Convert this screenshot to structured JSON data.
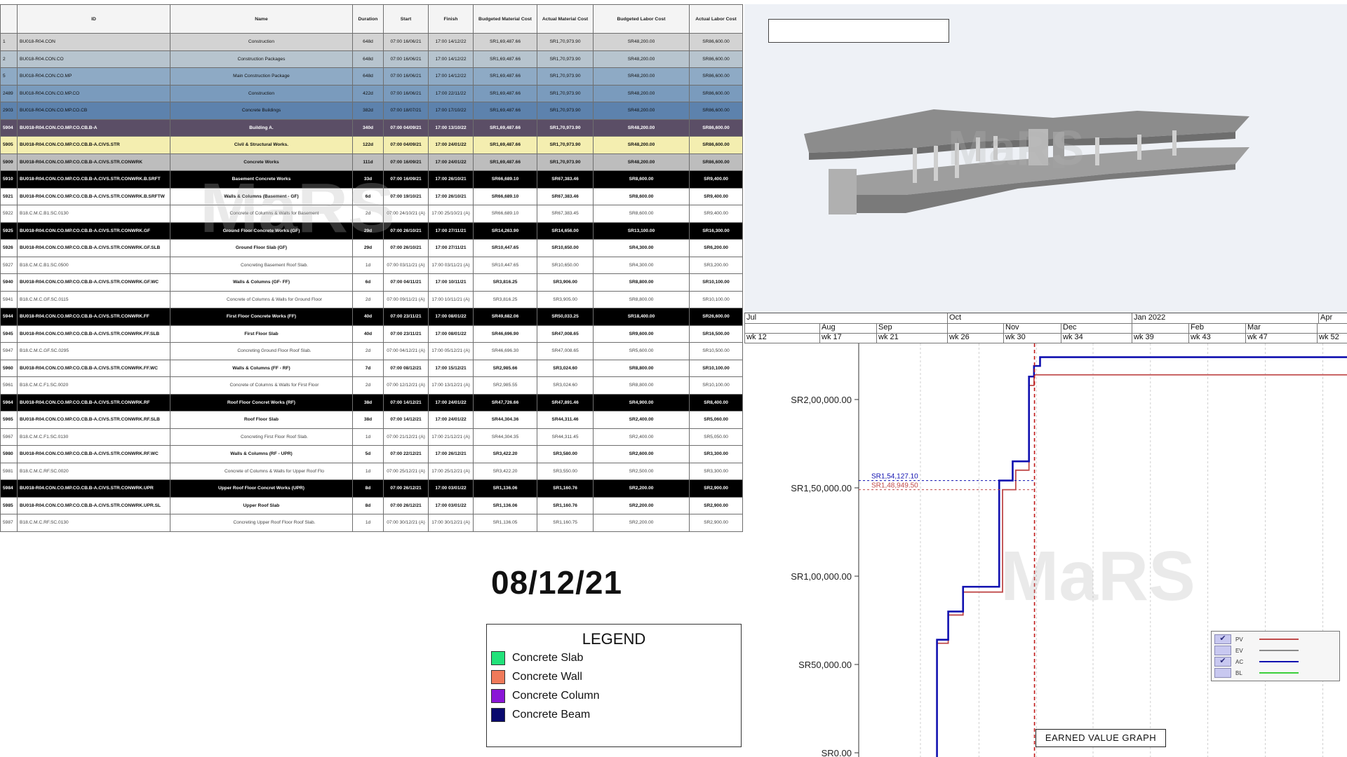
{
  "schedule": {
    "columns": [
      "ID",
      "Name",
      "Duration",
      "Start",
      "Finish",
      "Budgeted Material Cost",
      "Actual Material Cost",
      "Budgeted Labor Cost",
      "Actual Labor Cost"
    ],
    "rows": [
      {
        "no": "1",
        "id": "BU018-R04.CON",
        "name": "Construction",
        "dur": "648d",
        "start": "07:00 16/06/21",
        "finish": "17:00 14/12/22",
        "bmc": "SR1,69,487.66",
        "amc": "SR1,70,973.90",
        "blc": "SR48,200.00",
        "alc": "SR86,600.00",
        "style": "hl-gray",
        "indent": 0
      },
      {
        "no": "2",
        "id": "BU018-R04.CON.CO",
        "name": "Construction Packages",
        "dur": "648d",
        "start": "07:00 16/06/21",
        "finish": "17:00 14/12/22",
        "bmc": "SR1,69,487.66",
        "amc": "SR1,70,973.90",
        "blc": "SR48,200.00",
        "alc": "SR86,600.00",
        "style": "hl-steel",
        "indent": 1
      },
      {
        "no": "5",
        "id": "BU018-R04.CON.CO.MP",
        "name": "Main Construction Package",
        "dur": "648d",
        "start": "07:00 16/06/21",
        "finish": "17:00 14/12/22",
        "bmc": "SR1,69,487.66",
        "amc": "SR1,70,973.90",
        "blc": "SR48,200.00",
        "alc": "SR86,600.00",
        "style": "hl-blue",
        "indent": 2
      },
      {
        "no": "2489",
        "id": "BU018-R04.CON.CO.MP.CO",
        "name": "Construction",
        "dur": "422d",
        "start": "07:00 16/06/21",
        "finish": "17:00 22/11/22",
        "bmc": "SR1,69,487.66",
        "amc": "SR1,70,973.90",
        "blc": "SR48,200.00",
        "alc": "SR86,600.00",
        "style": "hl-blue2",
        "indent": 3
      },
      {
        "no": "2903",
        "id": "BU018-R04.CON.CO.MP.CO.CB",
        "name": "Concrete Buildings",
        "dur": "382d",
        "start": "07:00 18/07/21",
        "finish": "17:00 17/10/22",
        "bmc": "SR1,69,487.66",
        "amc": "SR1,70,973.90",
        "blc": "SR48,200.00",
        "alc": "SR86,600.00",
        "style": "hl-blue3",
        "indent": 4
      },
      {
        "no": "5904",
        "id": "BU018-R04.CON.CO.MP.CO.CB.B-A",
        "name": "Building A.",
        "dur": "340d",
        "start": "07:00 04/09/21",
        "finish": "17:00 13/10/22",
        "bmc": "SR1,69,487.66",
        "amc": "SR1,70,973.90",
        "blc": "SR48,200.00",
        "alc": "SR86,600.00",
        "style": "hl-purple",
        "indent": 5
      },
      {
        "no": "5905",
        "id": "BU018-R04.CON.CO.MP.CO.CB.B-A.CIVS.STR",
        "name": "Civil & Structural Works.",
        "dur": "122d",
        "start": "07:00 04/09/21",
        "finish": "17:00 24/01/22",
        "bmc": "SR1,69,487.66",
        "amc": "SR1,70,973.90",
        "blc": "SR48,200.00",
        "alc": "SR86,600.00",
        "style": "hl-yellow",
        "indent": 6
      },
      {
        "no": "5909",
        "id": "BU018-R04.CON.CO.MP.CO.CB.B-A.CIVS.STR.CONWRK",
        "name": "Concrete Works",
        "dur": "111d",
        "start": "07:00 16/09/21",
        "finish": "17:00 24/01/22",
        "bmc": "SR1,69,487.66",
        "amc": "SR1,70,973.90",
        "blc": "SR48,200.00",
        "alc": "SR86,600.00",
        "style": "hl-silver",
        "indent": 6
      },
      {
        "no": "5910",
        "id": "BU018-R04.CON.CO.MP.CO.CB.B-A.CIVS.STR.CONWRK.B.SRFT",
        "name": "Basement Concrete Works",
        "dur": "33d",
        "start": "07:00 16/09/21",
        "finish": "17:00 26/10/21",
        "bmc": "SR66,689.10",
        "amc": "SR67,383.46",
        "blc": "SR8,600.00",
        "alc": "SR9,400.00",
        "style": "hl-black",
        "indent": 4
      },
      {
        "no": "5921",
        "id": "BU018-R04.CON.CO.MP.CO.CB.B-A.CIVS.STR.CONWRK.B.SRFTW",
        "name": "Walls & Columns (Basement - GF)",
        "dur": "6d",
        "start": "07:00 19/10/21",
        "finish": "17:00 26/10/21",
        "bmc": "SR66,689.10",
        "amc": "SR67,383.46",
        "blc": "SR8,600.00",
        "alc": "SR9,400.00",
        "style": "hl-white",
        "indent": 4
      },
      {
        "no": "5922",
        "id": "B18.C.M.C.B1.SC.0130",
        "name": "Concrete of Columns & Walls for Basement",
        "dur": "2d",
        "start": "07:00 24/10/21 (A)",
        "finish": "17:00 25/10/21 (A)",
        "bmc": "SR66,689.10",
        "amc": "SR67,383.45",
        "blc": "SR8,600.00",
        "alc": "SR9,400.00",
        "style": "hl-task",
        "indent": 5
      },
      {
        "no": "5925",
        "id": "BU018-R04.CON.CO.MP.CO.CB.B-A.CIVS.STR.CONWRK.GF",
        "name": "Ground Floor Concrete Works (GF)",
        "dur": "29d",
        "start": "07:00 26/10/21",
        "finish": "17:00 27/11/21",
        "bmc": "SR14,263.90",
        "amc": "SR14,656.00",
        "blc": "SR13,100.00",
        "alc": "SR16,300.00",
        "style": "hl-black",
        "indent": 4
      },
      {
        "no": "5926",
        "id": "BU018-R04.CON.CO.MP.CO.CB.B-A.CIVS.STR.CONWRK.GF.SLB",
        "name": "Ground Floor Slab (GF)",
        "dur": "29d",
        "start": "07:00 26/10/21",
        "finish": "17:00 27/11/21",
        "bmc": "SR10,447.65",
        "amc": "SR10,650.00",
        "blc": "SR4,300.00",
        "alc": "SR6,200.00",
        "style": "hl-white",
        "indent": 4
      },
      {
        "no": "5927",
        "id": "B18.C.M.C.B1.SC.0500",
        "name": "Concreting Basement Roof Slab.",
        "dur": "1d",
        "start": "07:00 03/11/21 (A)",
        "finish": "17:00 03/11/21 (A)",
        "bmc": "SR10,447.65",
        "amc": "SR10,650.00",
        "blc": "SR4,300.00",
        "alc": "SR3,200.00",
        "style": "hl-task",
        "indent": 5
      },
      {
        "no": "5940",
        "id": "BU018-R04.CON.CO.MP.CO.CB.B-A.CIVS.STR.CONWRK.GF.WC",
        "name": "Walls & Columns (GF- FF)",
        "dur": "6d",
        "start": "07:00 04/11/21",
        "finish": "17:00 10/11/21",
        "bmc": "SR3,816.25",
        "amc": "SR3,906.00",
        "blc": "SR8,800.00",
        "alc": "SR10,100.00",
        "style": "hl-white",
        "indent": 4
      },
      {
        "no": "5941",
        "id": "B18.C.M.C.GF.SC.0115",
        "name": "Concrete of Columns & Walls for Ground Floor",
        "dur": "2d",
        "start": "07:00 09/11/21 (A)",
        "finish": "17:00 10/11/21 (A)",
        "bmc": "SR3,816.25",
        "amc": "SR3,905.00",
        "blc": "SR8,800.00",
        "alc": "SR10,100.00",
        "style": "hl-task",
        "indent": 5
      },
      {
        "no": "5944",
        "id": "BU018-R04.CON.CO.MP.CO.CB.B-A.CIVS.STR.CONWRK.FF",
        "name": "First Floor Concrete Works (FF)",
        "dur": "40d",
        "start": "07:00 23/11/21",
        "finish": "17:00 08/01/22",
        "bmc": "SR49,682.06",
        "amc": "SR50,033.25",
        "blc": "SR18,400.00",
        "alc": "SR26,600.00",
        "style": "hl-black",
        "indent": 4
      },
      {
        "no": "5945",
        "id": "BU018-R04.CON.CO.MP.CO.CB.B-A.CIVS.STR.CONWRK.FF.SLB",
        "name": "First Floor Slab",
        "dur": "40d",
        "start": "07:00 23/11/21",
        "finish": "17:00 08/01/22",
        "bmc": "SR46,696.90",
        "amc": "SR47,008.65",
        "blc": "SR9,600.00",
        "alc": "SR16,500.00",
        "style": "hl-white",
        "indent": 4
      },
      {
        "no": "5947",
        "id": "B18.C.M.C.GF.SC.0295",
        "name": "Concreting Ground Floor Roof Slab.",
        "dur": "2d",
        "start": "07:00 04/12/21 (A)",
        "finish": "17:00 05/12/21 (A)",
        "bmc": "SR46,696.30",
        "amc": "SR47,008.65",
        "blc": "SR5,600.00",
        "alc": "SR10,500.00",
        "style": "hl-task",
        "indent": 5
      },
      {
        "no": "5960",
        "id": "BU018-R04.CON.CO.MP.CO.CB.B-A.CIVS.STR.CONWRK.FF.WC",
        "name": "Walls & Columns (FF - RF)",
        "dur": "7d",
        "start": "07:00 08/12/21",
        "finish": "17:00 15/12/21",
        "bmc": "SR2,985.66",
        "amc": "SR3,024.60",
        "blc": "SR8,800.00",
        "alc": "SR10,100.00",
        "style": "hl-white",
        "indent": 4
      },
      {
        "no": "5961",
        "id": "B18.C.M.C.F1.SC.0020",
        "name": "Concrete of Columns & Walls for First Floor",
        "dur": "2d",
        "start": "07:00 12/12/21 (A)",
        "finish": "17:00 13/12/21 (A)",
        "bmc": "SR2,985.55",
        "amc": "SR3,024.60",
        "blc": "SR8,800.00",
        "alc": "SR10,100.00",
        "style": "hl-task",
        "indent": 5
      },
      {
        "no": "5964",
        "id": "BU018-R04.CON.CO.MP.CO.CB.B-A.CIVS.STR.CONWRK.RF",
        "name": "Roof Floor Concret Works (RF)",
        "dur": "38d",
        "start": "07:00 14/12/21",
        "finish": "17:00 24/01/22",
        "bmc": "SR47,726.66",
        "amc": "SR47,891.46",
        "blc": "SR4,900.00",
        "alc": "SR8,400.00",
        "style": "hl-black",
        "indent": 4
      },
      {
        "no": "5965",
        "id": "BU018-R04.CON.CO.MP.CO.CB.B-A.CIVS.STR.CONWRK.RF.SLB",
        "name": "Roof Floor Slab",
        "dur": "38d",
        "start": "07:00 14/12/21",
        "finish": "17:00 24/01/22",
        "bmc": "SR44,304.36",
        "amc": "SR44,311.46",
        "blc": "SR2,400.00",
        "alc": "SR5,060.00",
        "style": "hl-white",
        "indent": 4
      },
      {
        "no": "5967",
        "id": "B18.C.M.C.F1.SC.0130",
        "name": "Concreting First Floor Roof Slab.",
        "dur": "1d",
        "start": "07:00 21/12/21 (A)",
        "finish": "17:00 21/12/21 (A)",
        "bmc": "SR44,304.35",
        "amc": "SR44,311.45",
        "blc": "SR2,400.00",
        "alc": "SR5,050.00",
        "style": "hl-task",
        "indent": 5
      },
      {
        "no": "5980",
        "id": "BU018-R04.CON.CO.MP.CO.CB.B-A.CIVS.STR.CONWRK.RF.WC",
        "name": "Walls & Columns (RF - UPR)",
        "dur": "5d",
        "start": "07:00 22/12/21",
        "finish": "17:00 26/12/21",
        "bmc": "SR3,422.20",
        "amc": "SR3,580.00",
        "blc": "SR2,600.00",
        "alc": "SR3,300.00",
        "style": "hl-white",
        "indent": 4
      },
      {
        "no": "5981",
        "id": "B18.C.M.C.RF.SC.0020",
        "name": "Concrete of Columns & Walls for Upper Roof Flo",
        "dur": "1d",
        "start": "07:00 25/12/21 (A)",
        "finish": "17:00 25/12/21 (A)",
        "bmc": "SR3,422.20",
        "amc": "SR3,550.00",
        "blc": "SR2,500.00",
        "alc": "SR3,300.00",
        "style": "hl-task",
        "indent": 5
      },
      {
        "no": "5984",
        "id": "BU018-R04.CON.CO.MP.CO.CB.B-A.CIVS.STR.CONWRK.UPR",
        "name": "Upper Roof Floor Concret Works (UPR)",
        "dur": "8d",
        "start": "07:00 26/12/21",
        "finish": "17:00 03/01/22",
        "bmc": "SR1,136.06",
        "amc": "SR1,160.76",
        "blc": "SR2,200.00",
        "alc": "SR2,900.00",
        "style": "hl-black",
        "indent": 4
      },
      {
        "no": "5985",
        "id": "BU018-R04.CON.CO.MP.CO.CB.B-A.CIVS.STR.CONWRK.UPR.SL",
        "name": "Upper Roof Slab",
        "dur": "8d",
        "start": "07:00 26/12/21",
        "finish": "17:00 03/01/22",
        "bmc": "SR1,136.06",
        "amc": "SR1,160.76",
        "blc": "SR2,200.00",
        "alc": "SR2,900.00",
        "style": "hl-white",
        "indent": 4
      },
      {
        "no": "5987",
        "id": "B18.C.M.C.RF.SC.0130",
        "name": "Concreting Upper Roof Floor Roof Slab.",
        "dur": "1d",
        "start": "07:00 30/12/21 (A)",
        "finish": "17:00 30/12/21 (A)",
        "bmc": "SR1,136.05",
        "amc": "SR1,160.75",
        "blc": "SR2,200.00",
        "alc": "SR2,900.00",
        "style": "hl-task",
        "indent": 5
      }
    ]
  },
  "date_display": "08/12/21",
  "legend": {
    "title": "LEGEND",
    "items": [
      {
        "label": "Concrete Slab",
        "color": "#22e27a"
      },
      {
        "label": "Concrete Wall",
        "color": "#f07a5a"
      },
      {
        "label": "Concrete Column",
        "color": "#8a16d6"
      },
      {
        "label": "Concrete Beam",
        "color": "#0a0a6e"
      }
    ]
  },
  "watermark": "MaRS",
  "timescale": {
    "top": [
      {
        "label": "Jul",
        "w": 289
      },
      {
        "label": "Oct",
        "w": 263
      },
      {
        "label": "Jan 2022",
        "w": 266
      },
      {
        "label": "Apr",
        "w": 41
      }
    ],
    "mid": [
      {
        "label": "",
        "w": 107
      },
      {
        "label": "Aug",
        "w": 81
      },
      {
        "label": "Sep",
        "w": 101
      },
      {
        "label": "",
        "w": 80
      },
      {
        "label": "Nov",
        "w": 82
      },
      {
        "label": "Dec",
        "w": 101
      },
      {
        "label": "",
        "w": 81
      },
      {
        "label": "Feb",
        "w": 81
      },
      {
        "label": "Mar",
        "w": 102
      },
      {
        "label": "",
        "w": 43
      }
    ],
    "bottom": [
      {
        "label": "wk 12",
        "w": 107
      },
      {
        "label": "wk 17",
        "w": 81
      },
      {
        "label": "wk 21",
        "w": 101
      },
      {
        "label": "wk 26",
        "w": 80
      },
      {
        "label": "wk 30",
        "w": 82
      },
      {
        "label": "wk 34",
        "w": 101
      },
      {
        "label": "wk 39",
        "w": 81
      },
      {
        "label": "wk 43",
        "w": 81
      },
      {
        "label": "wk 47",
        "w": 102
      },
      {
        "label": "wk 52",
        "w": 43
      }
    ]
  },
  "chart_data": {
    "type": "line",
    "title": "EARNED VALUE GRAPH",
    "ylim": [
      0,
      230000
    ],
    "yticks": [
      {
        "v": 0,
        "label": "SR0.00"
      },
      {
        "v": 50000,
        "label": "SR50,000.00"
      },
      {
        "v": 100000,
        "label": "SR1,00,000.00"
      },
      {
        "v": 150000,
        "label": "SR1,50,000.00"
      },
      {
        "v": 200000,
        "label": "SR2,00,000.00"
      }
    ],
    "status_marker": {
      "date": "08/12/21"
    },
    "readouts": [
      {
        "label": "SR1,54,127.10",
        "series": "AC",
        "value": 154127.1
      },
      {
        "label": "SR1,48,949.50",
        "series": "PV",
        "value": 148949.5
      }
    ],
    "series": [
      {
        "name": "PV",
        "color": "#c04a4a",
        "checked": true,
        "points": [
          [
            0.1603,
            -10000
          ],
          [
            0.1603,
            62000
          ],
          [
            0.1833,
            62000
          ],
          [
            0.1833,
            78000
          ],
          [
            0.2137,
            78000
          ],
          [
            0.2137,
            91000
          ],
          [
            0.2946,
            91000
          ],
          [
            0.2946,
            148949.5
          ],
          [
            0.3216,
            148949.5
          ],
          [
            0.3216,
            160000
          ],
          [
            0.3487,
            160000
          ],
          [
            0.3487,
            208000
          ],
          [
            0.359,
            208000
          ],
          [
            0.359,
            214000
          ],
          [
            1.0,
            214000
          ]
        ]
      },
      {
        "name": "EV",
        "color": "#8a8a8a",
        "checked": false,
        "points": []
      },
      {
        "name": "AC",
        "color": "#1010b0",
        "checked": true,
        "points": [
          [
            0.1603,
            -10000
          ],
          [
            0.1603,
            64000
          ],
          [
            0.1833,
            64000
          ],
          [
            0.1833,
            80000
          ],
          [
            0.2137,
            80000
          ],
          [
            0.2137,
            94000
          ],
          [
            0.2877,
            94000
          ],
          [
            0.2877,
            154127.1
          ],
          [
            0.3153,
            154127.1
          ],
          [
            0.3153,
            165000
          ],
          [
            0.3487,
            165000
          ],
          [
            0.3487,
            213000
          ],
          [
            0.359,
            213000
          ],
          [
            0.359,
            219000
          ],
          [
            0.3714,
            219000
          ],
          [
            0.3714,
            224000
          ],
          [
            1.0,
            224000
          ]
        ]
      },
      {
        "name": "BL",
        "color": "#3bcf3b",
        "checked": false,
        "points": []
      }
    ]
  }
}
